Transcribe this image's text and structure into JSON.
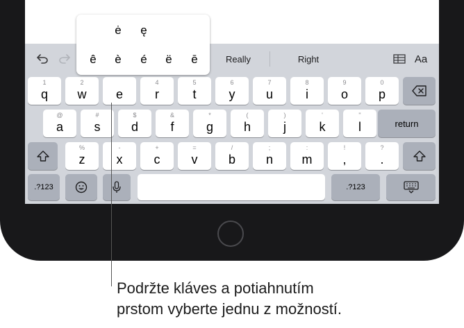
{
  "suggestions": {
    "undo_icon": "undo-arrow-icon",
    "redo_icon": "redo-arrow-icon",
    "word_left": "Really",
    "word_right": "Right",
    "table_icon": "table-icon",
    "format_label": "Aa"
  },
  "popup": {
    "row1": [
      "ė",
      "ę"
    ],
    "row2": [
      "ê",
      "è",
      "é",
      "ë",
      "ē"
    ]
  },
  "rows": {
    "row1": [
      {
        "alt": "1",
        "main": "q"
      },
      {
        "alt": "2",
        "main": "w"
      },
      {
        "alt": "",
        "main": "e"
      },
      {
        "alt": "4",
        "main": "r"
      },
      {
        "alt": "5",
        "main": "t"
      },
      {
        "alt": "6",
        "main": "y"
      },
      {
        "alt": "7",
        "main": "u"
      },
      {
        "alt": "8",
        "main": "i"
      },
      {
        "alt": "9",
        "main": "o"
      },
      {
        "alt": "0",
        "main": "p"
      }
    ],
    "row2": [
      {
        "alt": "@",
        "main": "a"
      },
      {
        "alt": "#",
        "main": "s"
      },
      {
        "alt": "$",
        "main": "d"
      },
      {
        "alt": "&",
        "main": "f"
      },
      {
        "alt": "*",
        "main": "g"
      },
      {
        "alt": "(",
        "main": "h"
      },
      {
        "alt": ")",
        "main": "j"
      },
      {
        "alt": "'",
        "main": "k"
      },
      {
        "alt": "\"",
        "main": "l"
      }
    ],
    "row3": [
      {
        "alt": "%",
        "main": "z"
      },
      {
        "alt": "-",
        "main": "x"
      },
      {
        "alt": "+",
        "main": "c"
      },
      {
        "alt": "=",
        "main": "v"
      },
      {
        "alt": "/",
        "main": "b"
      },
      {
        "alt": ";",
        "main": "n"
      },
      {
        "alt": ":",
        "main": "m"
      },
      {
        "alt": "!",
        "main": ","
      },
      {
        "alt": "?",
        "main": "."
      }
    ]
  },
  "special": {
    "delete_icon": "delete-backspace-icon",
    "return_label": "return",
    "shift_icon": "shift-arrow-icon",
    "numbers_label": ".?123",
    "emoji_icon": "emoji-icon",
    "mic_icon": "microphone-icon",
    "hide_keyboard_icon": "keyboard-hide-icon"
  },
  "caption": {
    "line1": "Podržte kláves a potiahnutím",
    "line2": "prstom vyberte jednu z možností."
  }
}
